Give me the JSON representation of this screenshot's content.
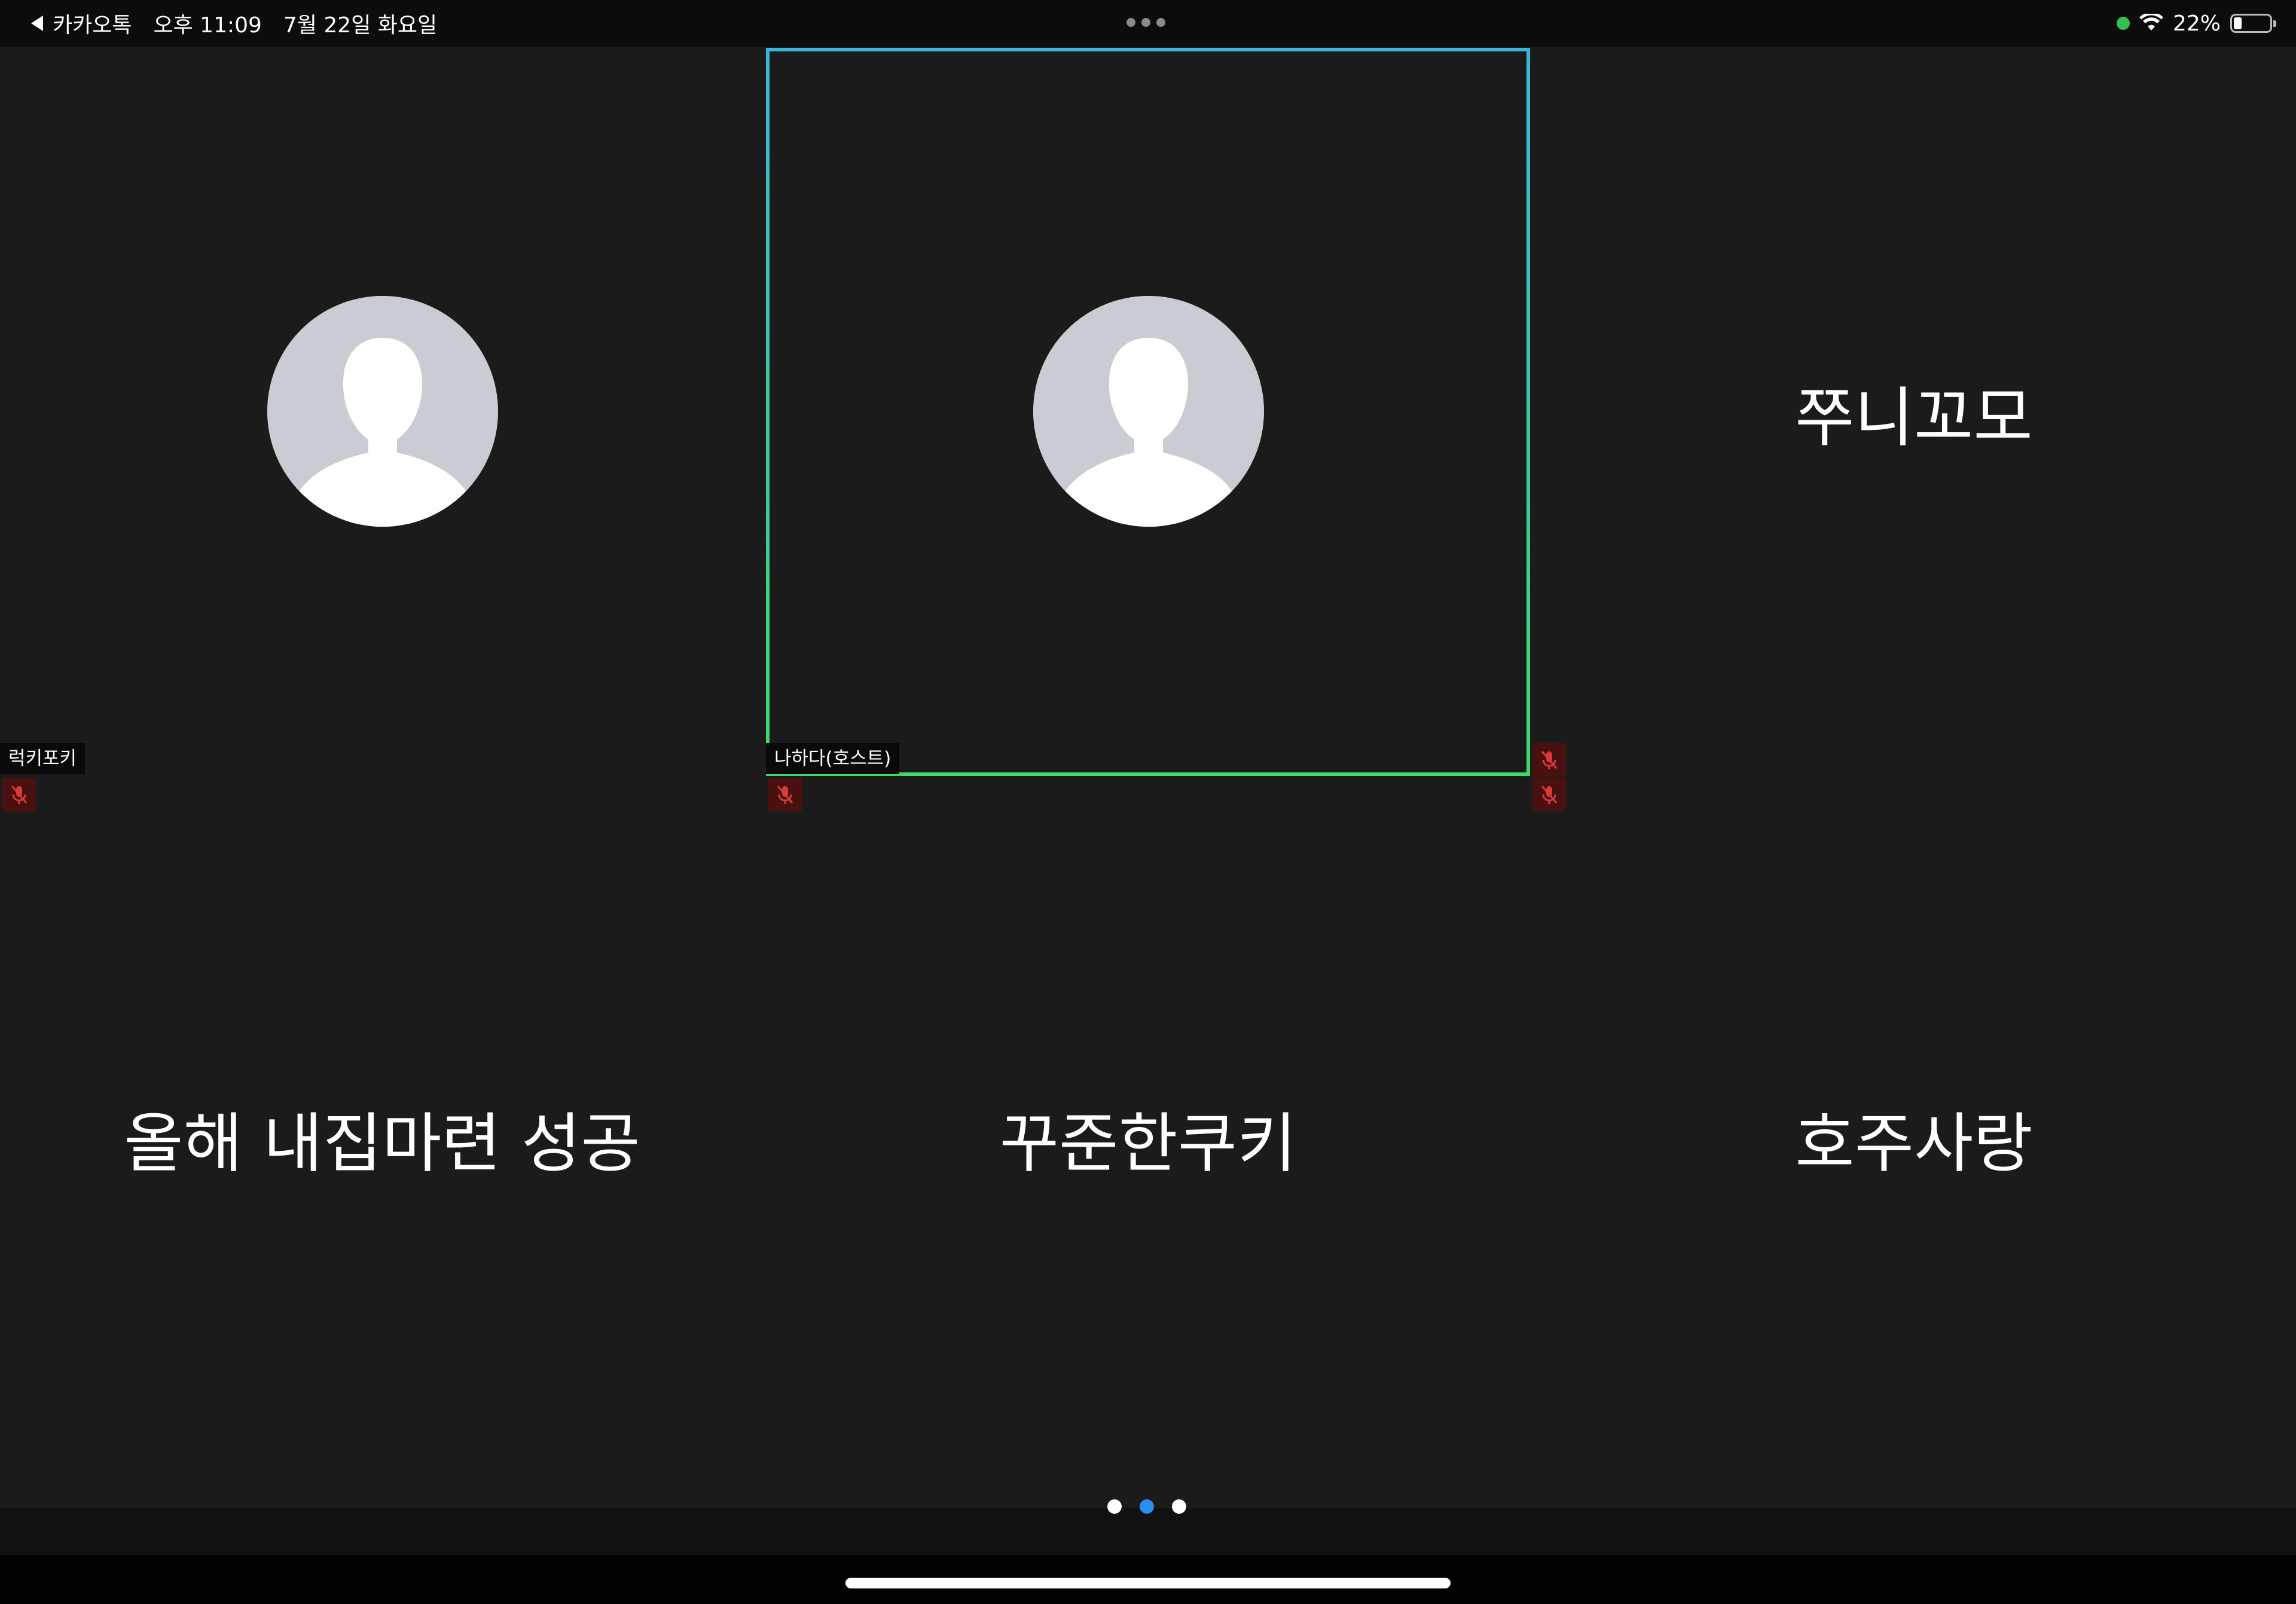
{
  "status_bar": {
    "back_app": "카카오톡",
    "time": "오후 11:09",
    "date": "7월 22일 화요일",
    "battery": "22%",
    "battery_level": 0.22,
    "recording_dot_color": "#32c14d"
  },
  "participants": [
    {
      "name": "럭키포키",
      "display": "avatar",
      "muted": true
    },
    {
      "name": "나하다(호스트)",
      "display": "avatar",
      "muted": true,
      "active_speaker": true
    },
    {
      "name": "쭈니꼬모",
      "display": "name",
      "muted": true
    },
    {
      "name": "올해 내집마련 성공",
      "display": "name"
    },
    {
      "name": "꾸준한쿠키",
      "display": "name"
    },
    {
      "name": "호주사랑",
      "display": "name"
    }
  ],
  "pagination": {
    "pages": 3,
    "current": 2,
    "active_color": "#2a8df0"
  },
  "colors": {
    "background": "#1b1b1b",
    "active_border_top": "#3cb6d8",
    "active_border_bottom": "#3ed86b",
    "mute_icon": "#d63a3a"
  },
  "icons": {
    "back": "back-arrow-icon",
    "more": "more-dots-icon",
    "wifi": "wifi-icon",
    "battery": "battery-icon",
    "mute": "mic-muted-icon",
    "avatar": "default-avatar-icon"
  }
}
